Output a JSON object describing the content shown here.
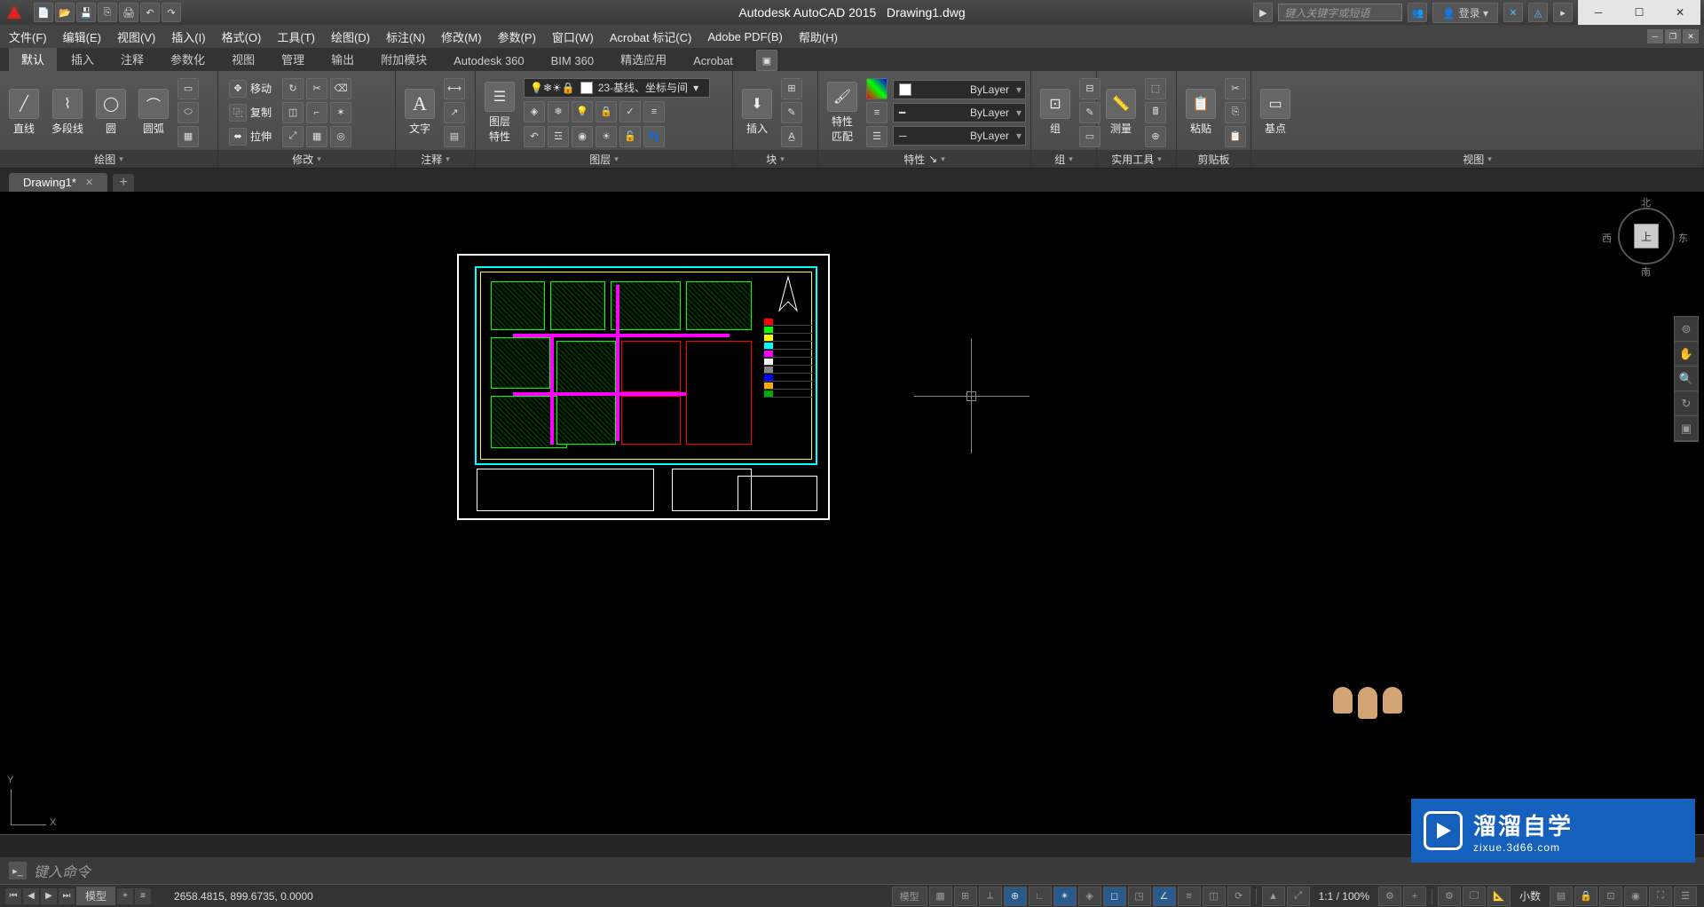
{
  "title": {
    "app": "Autodesk AutoCAD 2015",
    "file": "Drawing1.dwg"
  },
  "search_placeholder": "键入关键字或短语",
  "login": "登录",
  "menus": [
    "文件(F)",
    "编辑(E)",
    "视图(V)",
    "插入(I)",
    "格式(O)",
    "工具(T)",
    "绘图(D)",
    "标注(N)",
    "修改(M)",
    "参数(P)",
    "窗口(W)",
    "Acrobat 标记(C)",
    "Adobe PDF(B)",
    "帮助(H)"
  ],
  "ribbon_tabs": [
    "默认",
    "插入",
    "注释",
    "参数化",
    "视图",
    "管理",
    "输出",
    "附加模块",
    "Autodesk 360",
    "BIM 360",
    "精选应用",
    "Acrobat"
  ],
  "active_ribbon_tab": 0,
  "panels": {
    "draw": {
      "title": "绘图",
      "btns": {
        "line": "直线",
        "pline": "多段线",
        "circle": "圆",
        "arc": "圆弧"
      }
    },
    "modify": {
      "title": "修改",
      "btns": {
        "move": "移动",
        "copy": "复制",
        "stretch": "拉伸"
      }
    },
    "annot": {
      "title": "注释",
      "text": "文字"
    },
    "layers": {
      "title": "图层",
      "props": "图层\n特性",
      "current": "23-基线、坐标与间"
    },
    "block": {
      "title": "块",
      "insert": "插入"
    },
    "props": {
      "title": "特性",
      "match": "特性\n匹配",
      "bylayer": "ByLayer"
    },
    "group": {
      "title": "组",
      "btn": "组"
    },
    "utils": {
      "title": "实用工具",
      "measure": "测量"
    },
    "clip": {
      "title": "剪贴板",
      "paste": "粘贴"
    },
    "view": {
      "title": "视图",
      "base": "基点"
    }
  },
  "file_tab": "Drawing1*",
  "viewcube": {
    "face": "上",
    "n": "北",
    "s": "南",
    "e": "东",
    "w": "西"
  },
  "ucs": {
    "x": "X",
    "y": "Y"
  },
  "cmd_placeholder": "键入命令",
  "status": {
    "layout": "模型",
    "coords": "2658.4815, 899.6735, 0.0000",
    "model_btn": "模型",
    "scale": "1:1 / 100%",
    "decimal": "小数"
  },
  "watermark": {
    "main": "溜溜自学",
    "sub": "zixue.3d66.com"
  }
}
